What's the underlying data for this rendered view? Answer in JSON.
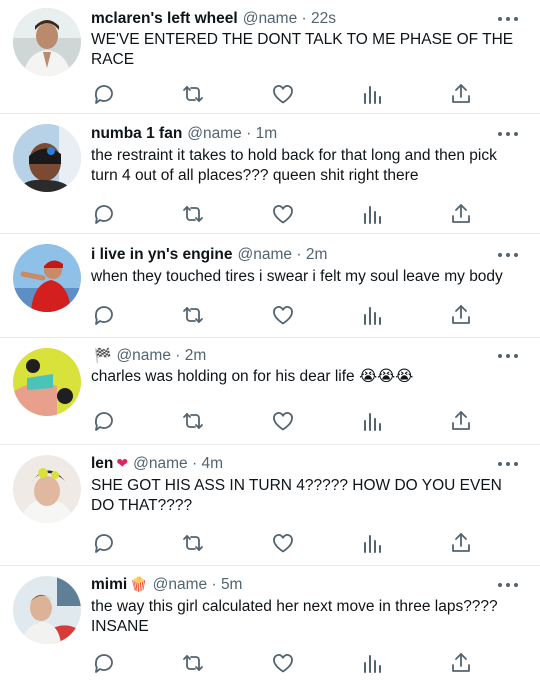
{
  "tweets": [
    {
      "name": "mclaren's left wheel",
      "name_emoji": "",
      "handle": "@name",
      "sep": "·",
      "time": "22s",
      "text": "WE'VE ENTERED THE DONT TALK TO ME PHASE OF THE RACE"
    },
    {
      "name": "numba 1 fan",
      "name_emoji": "",
      "handle": "@name",
      "sep": "·",
      "time": "1m",
      "text": "the restraint it takes to hold back for that long and then pick turn 4 out of all places??? queen shit right there"
    },
    {
      "name": "i live in yn's engine",
      "name_emoji": "",
      "handle": "@name",
      "sep": "·",
      "time": "2m",
      "text": "when they touched tires i swear i felt my soul leave my body"
    },
    {
      "name": "",
      "name_emoji": "🏁",
      "handle": "@name",
      "sep": "·",
      "time": "2m",
      "text": "charles was holding on for his dear life 😭😭😭"
    },
    {
      "name": "len",
      "name_emoji": "❤",
      "handle": "@name",
      "sep": "·",
      "time": "4m",
      "text": "SHE GOT HIS ASS IN TURN 4????? HOW DO YOU EVEN DO THAT????"
    },
    {
      "name": "mimi",
      "name_emoji": "🍿",
      "handle": "@name",
      "sep": "·",
      "time": "5m",
      "text": "the way this girl calculated her next move in three laps???? INSANE"
    }
  ],
  "icons": {
    "reply": "reply-icon",
    "retweet": "retweet-icon",
    "like": "like-icon",
    "stats": "stats-icon",
    "share": "share-icon",
    "more": "more-options-icon"
  },
  "colors": {
    "text": "#0f1419",
    "secondary": "#536471",
    "divider": "#e6ecf0"
  }
}
